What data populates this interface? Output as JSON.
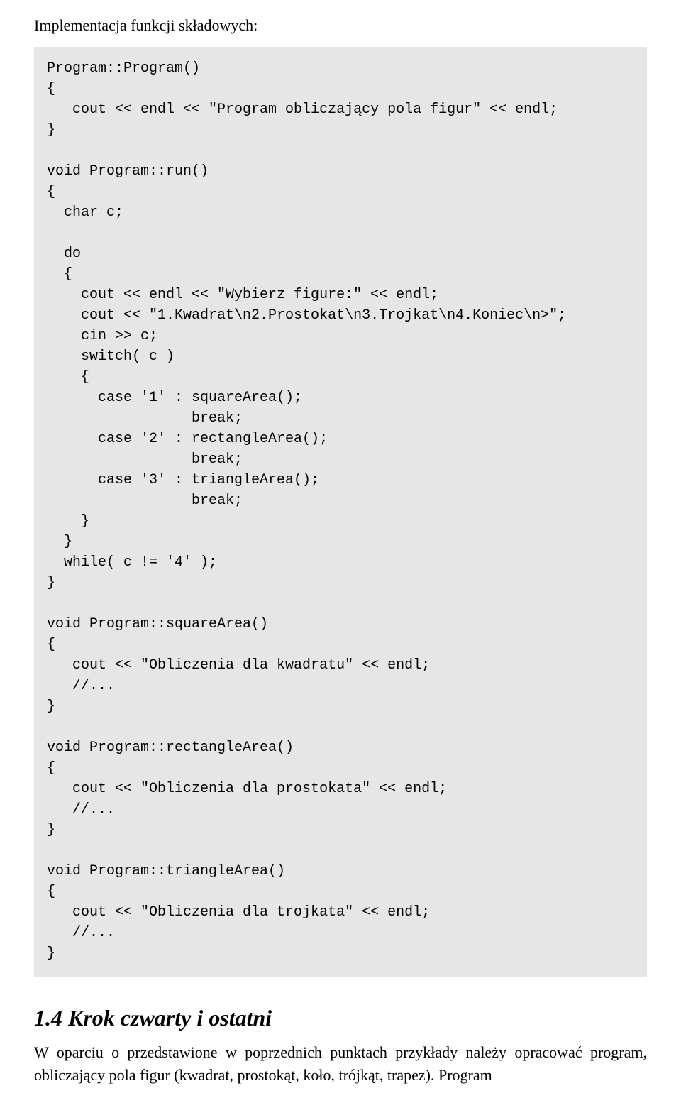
{
  "intro_text": "Implementacja funkcji składowych:",
  "code": "Program::Program()\n{\n   cout << endl << \"Program obliczający pola figur\" << endl;\n}\n\nvoid Program::run()\n{\n  char c;\n\n  do\n  {\n    cout << endl << \"Wybierz figure:\" << endl;\n    cout << \"1.Kwadrat\\n2.Prostokat\\n3.Trojkat\\n4.Koniec\\n>\";\n    cin >> c;\n    switch( c )\n    {\n      case '1' : squareArea();\n                 break;\n      case '2' : rectangleArea();\n                 break;\n      case '3' : triangleArea();\n                 break;\n    }\n  }\n  while( c != '4' );\n}\n\nvoid Program::squareArea()\n{\n   cout << \"Obliczenia dla kwadratu\" << endl;\n   //...\n}\n\nvoid Program::rectangleArea()\n{\n   cout << \"Obliczenia dla prostokata\" << endl;\n   //...\n}\n\nvoid Program::triangleArea()\n{\n   cout << \"Obliczenia dla trojkata\" << endl;\n   //...\n}",
  "heading": "1.4 Krok czwarty i ostatni",
  "body": "W oparciu o przedstawione w poprzednich punktach przykłady należy opracować program, obliczający pola figur (kwadrat, prostokąt, koło, trójkąt, trapez). Program"
}
